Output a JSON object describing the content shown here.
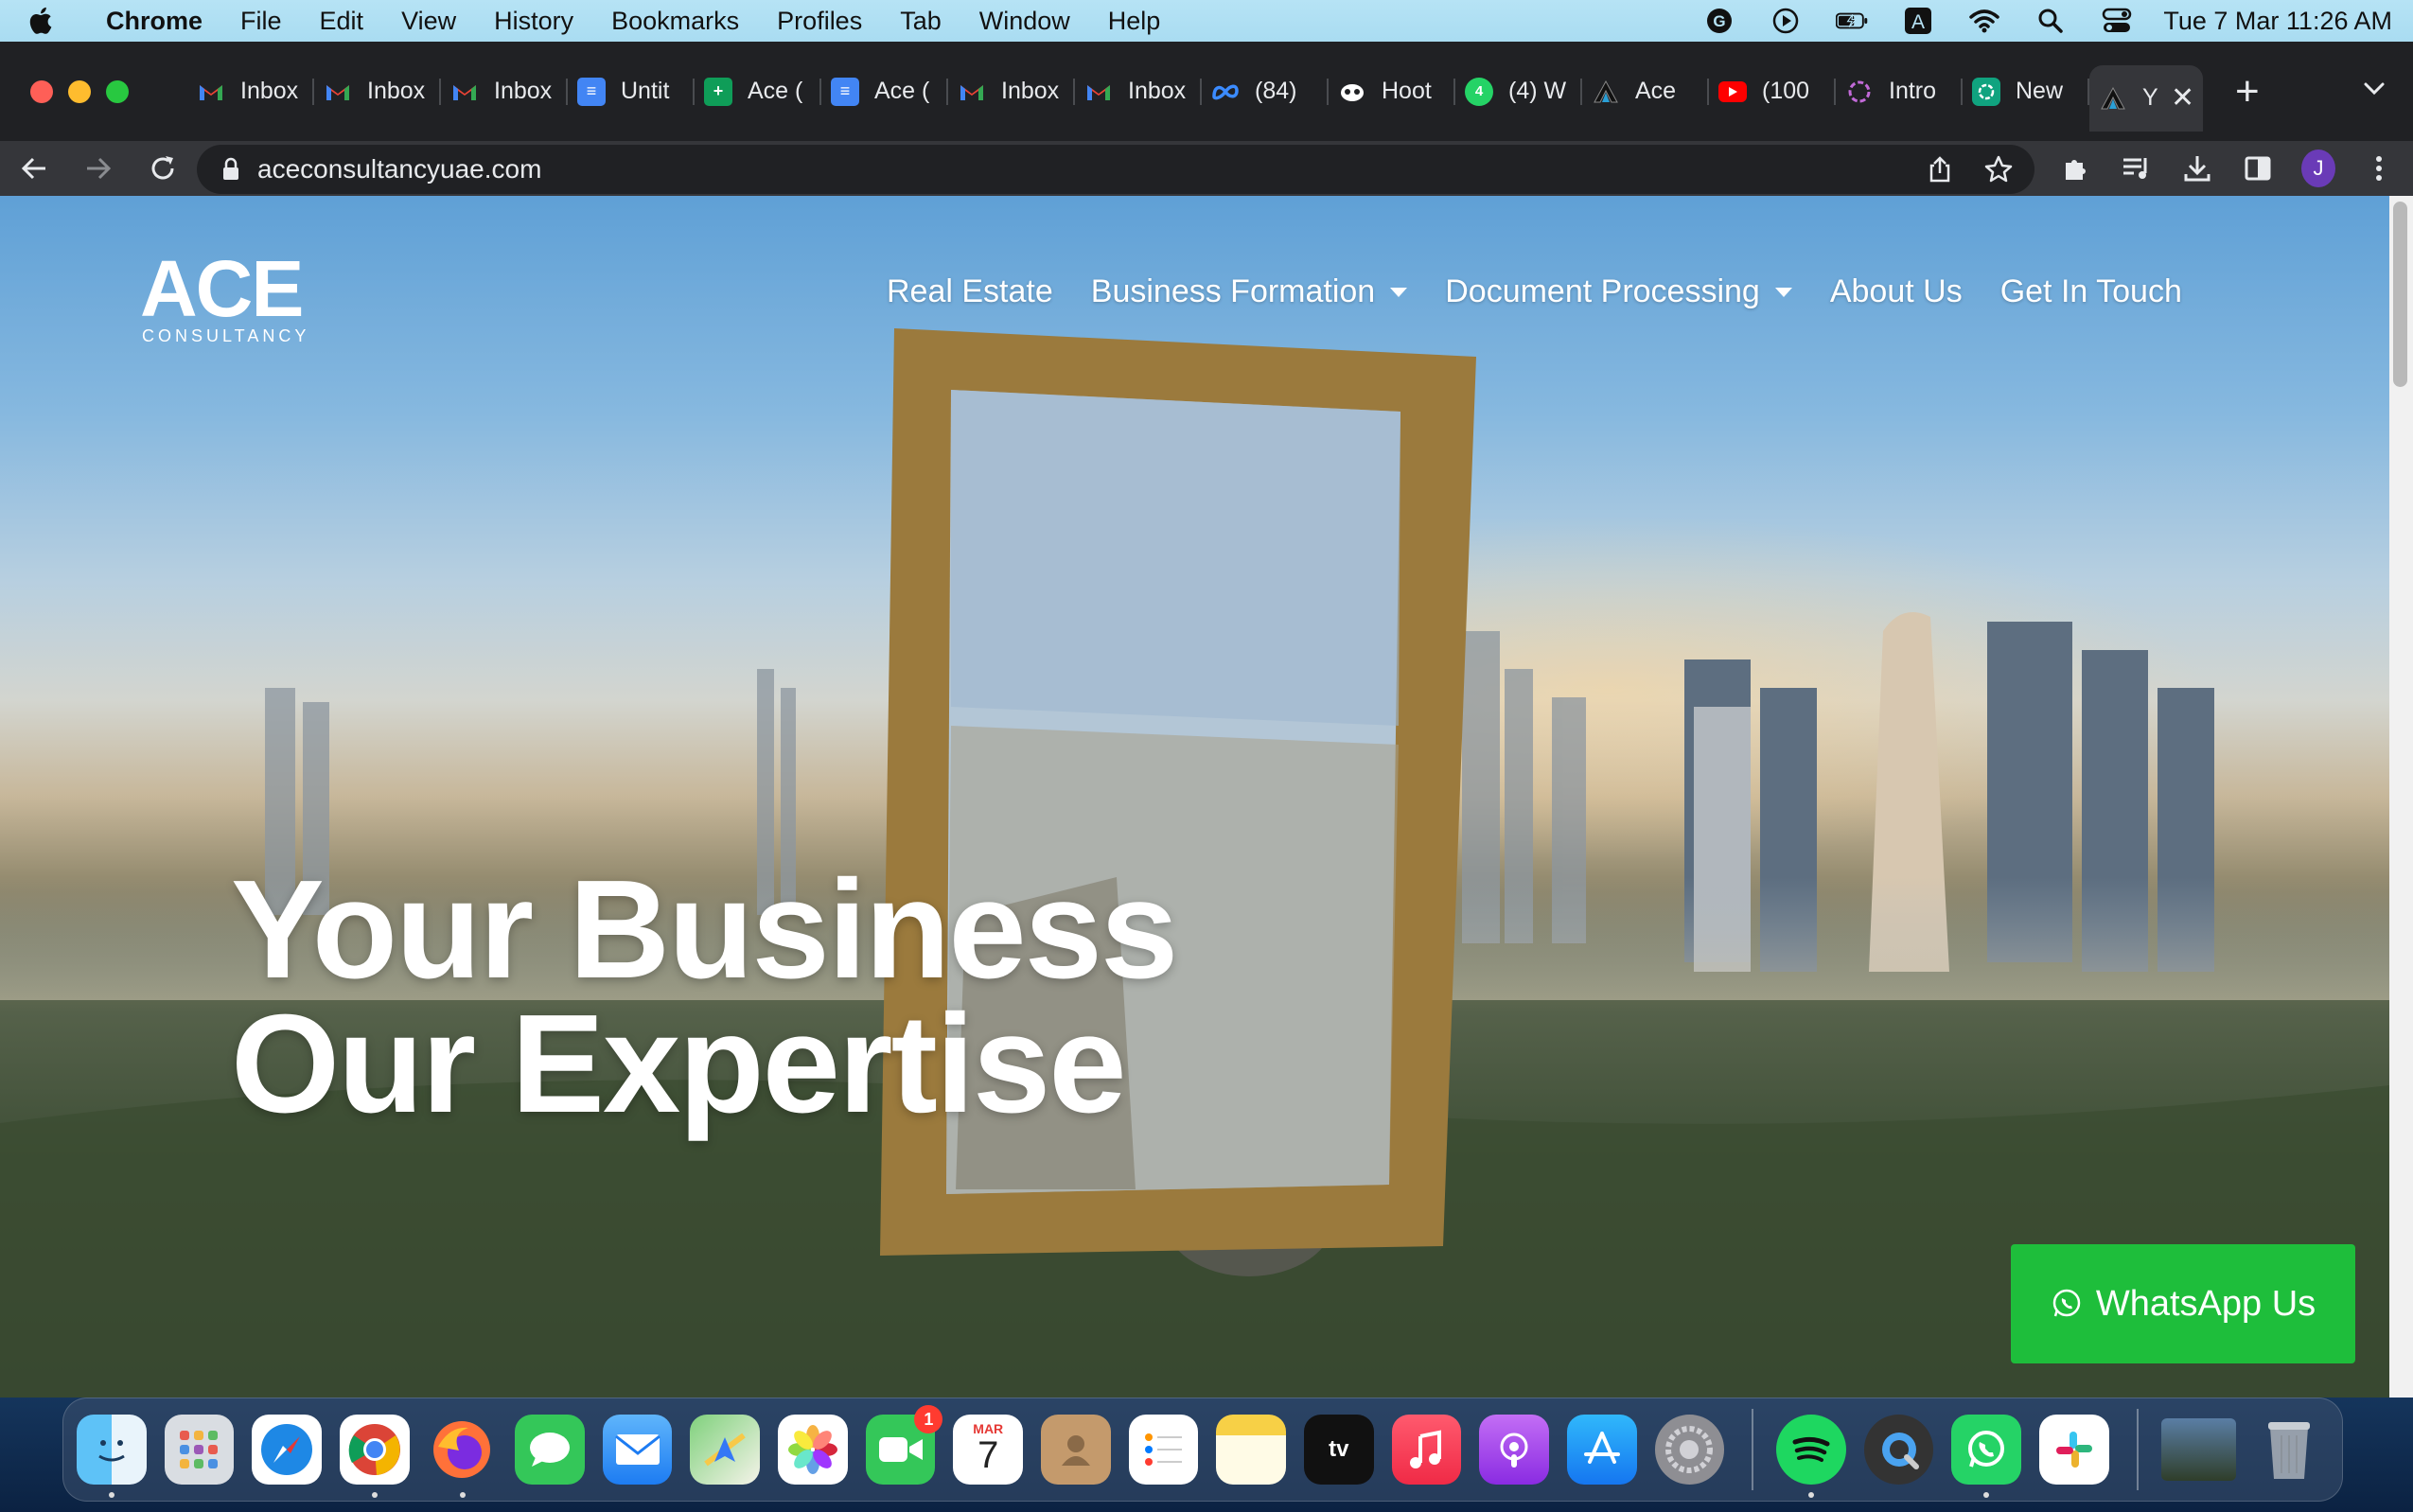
{
  "menubar": {
    "app_name": "Chrome",
    "items": [
      "File",
      "Edit",
      "View",
      "History",
      "Bookmarks",
      "Profiles",
      "Tab",
      "Window",
      "Help"
    ],
    "clock": "Tue 7 Mar  11:26 AM"
  },
  "tabs": [
    {
      "title": "Inbox",
      "icon": "gmail-icon"
    },
    {
      "title": "Inbox",
      "icon": "gmail-icon"
    },
    {
      "title": "Inbox",
      "icon": "gmail-icon"
    },
    {
      "title": "Untit",
      "icon": "google-docs-icon"
    },
    {
      "title": "Ace (",
      "icon": "google-sheets-icon"
    },
    {
      "title": "Ace (",
      "icon": "google-docs-icon"
    },
    {
      "title": "Inbox",
      "icon": "gmail-icon"
    },
    {
      "title": "Inbox",
      "icon": "gmail-icon"
    },
    {
      "title": "(84)",
      "icon": "meta-icon"
    },
    {
      "title": "Hoot",
      "icon": "hootsuite-icon"
    },
    {
      "title": "(4) W",
      "icon": "whatsapp-icon"
    },
    {
      "title": "Ace",
      "icon": "ace-icon"
    },
    {
      "title": "(100",
      "icon": "youtube-icon"
    },
    {
      "title": "Intro",
      "icon": "openai-icon"
    },
    {
      "title": "New",
      "icon": "chatgpt-icon"
    },
    {
      "title": "Y",
      "icon": "ace-icon",
      "active": true
    }
  ],
  "address_bar": {
    "url": "aceconsultancyuae.com"
  },
  "site": {
    "logo_text": "ACE",
    "logo_subtext": "CONSULTANCY",
    "nav": [
      {
        "label": "Real Estate",
        "dropdown": false
      },
      {
        "label": "Business Formation",
        "dropdown": true
      },
      {
        "label": "Document Processing",
        "dropdown": true
      },
      {
        "label": "About Us",
        "dropdown": false
      },
      {
        "label": "Get In Touch",
        "dropdown": false
      }
    ],
    "hero_line1": "Your Business",
    "hero_line2": "Our Expertise",
    "whatsapp_label": "WhatsApp Us"
  },
  "profile_initial": "J",
  "dock": {
    "calendar_month": "MAR",
    "calendar_day": "7",
    "facetime_badge": "1",
    "tv_label": "tv",
    "apps": [
      "finder-icon",
      "launchpad-icon",
      "safari-icon",
      "chrome-icon",
      "firefox-icon",
      "messages-icon",
      "mail-icon",
      "maps-icon",
      "photos-icon",
      "facetime-icon",
      "calendar-icon",
      "contacts-icon",
      "reminders-icon",
      "notes-icon",
      "appletv-icon",
      "music-icon",
      "podcasts-icon",
      "appstore-icon",
      "system-settings-icon",
      "spotify-icon",
      "quicktime-icon",
      "whatsapp-icon",
      "slack-icon",
      "preview-icon",
      "trash-icon"
    ]
  },
  "colors": {
    "whatsapp_green": "#1ebe3b",
    "chrome_dark": "#202124",
    "menubar_blue": "#b6e3f5"
  }
}
